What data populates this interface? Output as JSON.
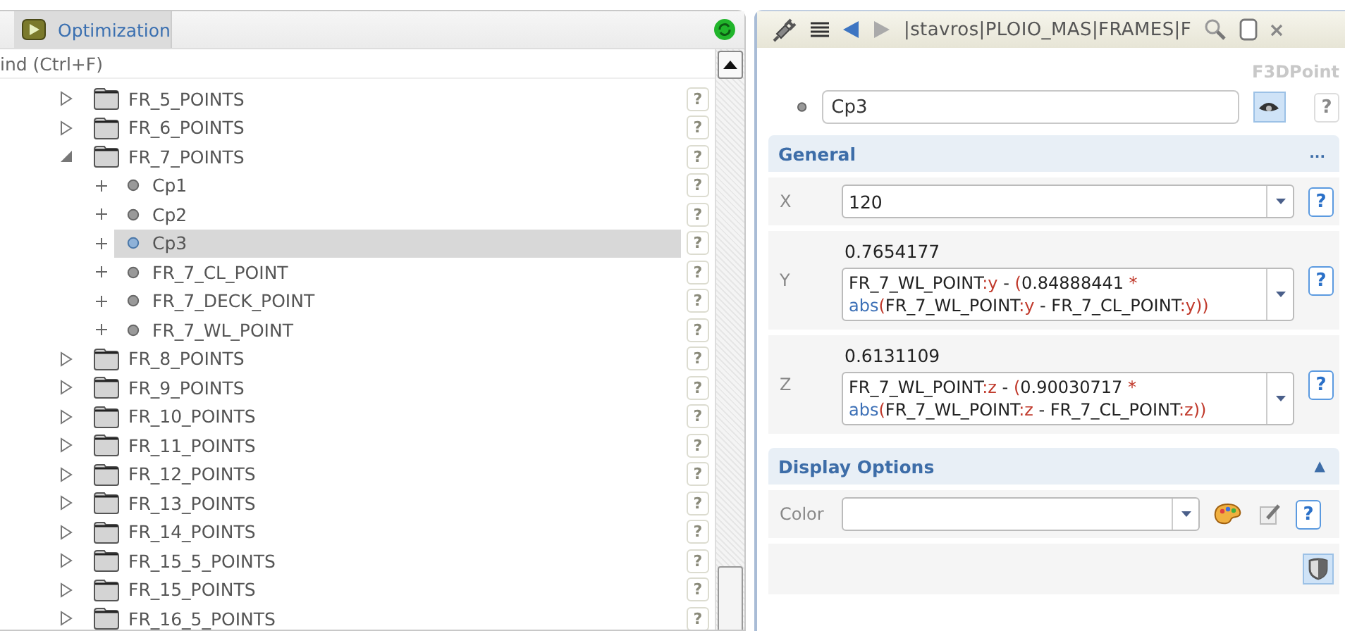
{
  "left_panel": {
    "tab": {
      "label": "Optimization",
      "selected": true
    },
    "find": {
      "placeholder": "ind (Ctrl+F)"
    },
    "tree": [
      {
        "label": "FR_5_POINTS",
        "kind": "folder",
        "expanded": false,
        "selected": false,
        "help": "?"
      },
      {
        "label": "FR_6_POINTS",
        "kind": "folder",
        "expanded": false,
        "selected": false,
        "help": "?"
      },
      {
        "label": "FR_7_POINTS",
        "kind": "folder",
        "expanded": true,
        "selected": false,
        "help": "?",
        "children": [
          {
            "label": "Cp1",
            "kind": "point",
            "selected": false,
            "help": "?"
          },
          {
            "label": "Cp2",
            "kind": "point",
            "selected": false,
            "help": "?"
          },
          {
            "label": "Cp3",
            "kind": "point",
            "selected": true,
            "help": "?"
          },
          {
            "label": "FR_7_CL_POINT",
            "kind": "point",
            "selected": false,
            "help": "?"
          },
          {
            "label": "FR_7_DECK_POINT",
            "kind": "point",
            "selected": false,
            "help": "?"
          },
          {
            "label": "FR_7_WL_POINT",
            "kind": "point",
            "selected": false,
            "help": "?"
          }
        ]
      },
      {
        "label": "FR_8_POINTS",
        "kind": "folder",
        "expanded": false,
        "selected": false,
        "help": "?"
      },
      {
        "label": "FR_9_POINTS",
        "kind": "folder",
        "expanded": false,
        "selected": false,
        "help": "?"
      },
      {
        "label": "FR_10_POINTS",
        "kind": "folder",
        "expanded": false,
        "selected": false,
        "help": "?"
      },
      {
        "label": "FR_11_POINTS",
        "kind": "folder",
        "expanded": false,
        "selected": false,
        "help": "?"
      },
      {
        "label": "FR_12_POINTS",
        "kind": "folder",
        "expanded": false,
        "selected": false,
        "help": "?"
      },
      {
        "label": "FR_13_POINTS",
        "kind": "folder",
        "expanded": false,
        "selected": false,
        "help": "?"
      },
      {
        "label": "FR_14_POINTS",
        "kind": "folder",
        "expanded": false,
        "selected": false,
        "help": "?"
      },
      {
        "label": "FR_15_5_POINTS",
        "kind": "folder",
        "expanded": false,
        "selected": false,
        "help": "?"
      },
      {
        "label": "FR_15_POINTS",
        "kind": "folder",
        "expanded": false,
        "selected": false,
        "help": "?"
      },
      {
        "label": "FR_16_5_POINTS",
        "kind": "folder",
        "expanded": false,
        "selected": false,
        "help": "?"
      }
    ]
  },
  "right_panel": {
    "path": "|stavros|PLOIO_MAS|FRAMES|F",
    "type_label": "F3DPoint",
    "name": "Cp3",
    "name_help": {
      "label": "?",
      "enabled": false
    },
    "sections": [
      {
        "title": "General",
        "toggle": "...",
        "fields": [
          {
            "kind": "combo",
            "label": "X",
            "value": "120",
            "help": "?"
          },
          {
            "kind": "formula",
            "label": "Y",
            "result": "0.7654177",
            "help": "?",
            "lines": [
              [
                {
                  "kind": "text",
                  "text": "FR_7_WL_POINT"
                },
                {
                  "kind": "sym",
                  "text": ":y"
                },
                {
                  "kind": "text",
                  "text": " - "
                },
                {
                  "kind": "sym",
                  "text": "("
                },
                {
                  "kind": "text",
                  "text": "0.84888441 "
                },
                {
                  "kind": "sym",
                  "text": "*"
                }
              ],
              [
                {
                  "kind": "func",
                  "text": "abs"
                },
                {
                  "kind": "sym",
                  "text": "("
                },
                {
                  "kind": "text",
                  "text": "FR_7_WL_POINT"
                },
                {
                  "kind": "sym",
                  "text": ":y"
                },
                {
                  "kind": "text",
                  "text": " - FR_7_CL_POINT"
                },
                {
                  "kind": "sym",
                  "text": ":y))"
                }
              ]
            ]
          },
          {
            "kind": "formula",
            "label": "Z",
            "result": "0.6131109",
            "help": "?",
            "lines": [
              [
                {
                  "kind": "text",
                  "text": "FR_7_WL_POINT"
                },
                {
                  "kind": "sym",
                  "text": ":z"
                },
                {
                  "kind": "text",
                  "text": " - "
                },
                {
                  "kind": "sym",
                  "text": "("
                },
                {
                  "kind": "text",
                  "text": "0.90030717 "
                },
                {
                  "kind": "sym",
                  "text": "*"
                }
              ],
              [
                {
                  "kind": "func",
                  "text": "abs"
                },
                {
                  "kind": "sym",
                  "text": "("
                },
                {
                  "kind": "text",
                  "text": "FR_7_WL_POINT"
                },
                {
                  "kind": "sym",
                  "text": ":z"
                },
                {
                  "kind": "text",
                  "text": " - FR_7_CL_POINT"
                },
                {
                  "kind": "sym",
                  "text": ":z))"
                }
              ]
            ]
          }
        ]
      },
      {
        "title": "Display Options",
        "toggle": "▲",
        "fields": [
          {
            "kind": "color",
            "label": "Color",
            "help": "?"
          },
          {
            "kind": "actions"
          }
        ]
      }
    ]
  }
}
